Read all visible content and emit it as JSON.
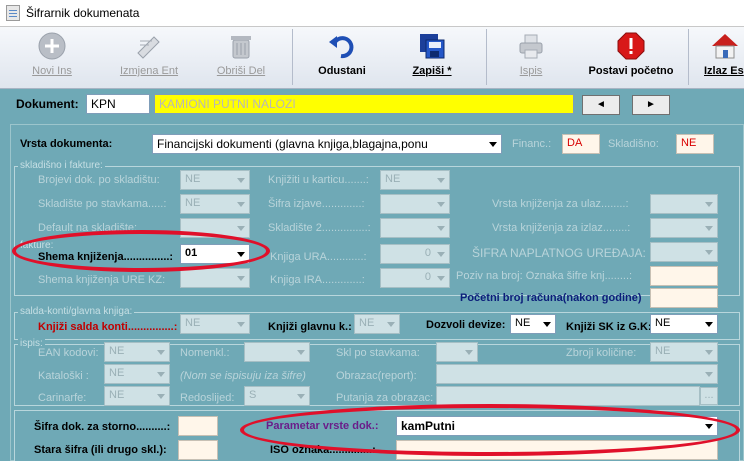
{
  "window": {
    "title": "Šifrarnik dokumenata"
  },
  "toolbar": {
    "new_label": "Novi Ins",
    "edit_label": "Izmjena Ent",
    "delete_label": "Obriši Del",
    "cancel_label": "Odustani",
    "save_label": "Zapiši *",
    "print_label": "Ispis",
    "reset_label": "Postavi početno",
    "exit_label": "Izlaz Es"
  },
  "document": {
    "label": "Dokument:",
    "code": "KPN",
    "name": "KAMIONI PUTNI NALOZI",
    "prev_label": "◄",
    "next_label": "►"
  },
  "vrsta": {
    "label": "Vrsta dokumenta:",
    "value": "Financijski dokumenti (glavna knjiga,blagajna,ponu",
    "financ_label": "Financ.:",
    "financ_value": "DA",
    "skladisno_label": "Skladišno:",
    "skladisno_value": "NE"
  },
  "skladisno": {
    "title": "skladišno i fakture:",
    "brojevi_label": "Brojevi dok. po skladištu:",
    "brojevi_value": "NE",
    "skladiste_label": "Skladište po stavkama.....:",
    "skladiste_value": "NE",
    "default_label": "Default na skladište:",
    "knjiziti_label": "Knjižiti u karticu.......:",
    "knjiziti_value": "NE",
    "sifra_izjave_label": "Šifra izjave.............:",
    "skladiste2_label": "Skladište 2...............:",
    "vrsta_ulaz_label": "Vrsta knjiženja za ulaz........:",
    "vrsta_izlaz_label": "Vrsta knjiženja za izlaz........:"
  },
  "fakture": {
    "title": "fakture:",
    "shema_label": "Shema knjiženja...............:",
    "shema_value": "01",
    "shema_ure_label": "Shema knjiženja URE KZ:",
    "knjiga_ura_label": "Knjiga URA............:",
    "knjiga_ura_value": "0",
    "knjiga_ira_label": "Knjiga IRA.............:",
    "knjiga_ira_value": "0",
    "naplatni_label": "ŠIFRA NAPLATNOG UREĐAJA:",
    "poziv_label": "Poziv na broj: Oznaka šifre knj........:",
    "pocetni_label": "Početni broj računa(nakon godine)"
  },
  "saldakonti": {
    "title": "salda-konti/glavna knjiga:",
    "knjizi_sk_label": "Knjiži salda konti...............:",
    "knjizi_sk_value": "NE",
    "knjizi_gk_label": "Knjiži glavnu k.:",
    "knjizi_gk_value": "NE",
    "dozvoli_label": "Dozvoli devize:",
    "dozvoli_value": "NE",
    "sk_gk_label": "Knjiži SK iz G.K:",
    "sk_gk_value": "NE"
  },
  "ispis": {
    "title": "ispis:",
    "ean_label": "EAN kodovi:",
    "ean_value": "NE",
    "nomenkl_label": "Nomenkl.:",
    "skl_label": "Skl po stavkama:",
    "zbroji_label": "Zbroji količine:",
    "zbroji_value": "NE",
    "katalog_label": "Kataloški :",
    "katalog_value": "NE",
    "nom_note": "(Nom se ispisuju iza šifre)",
    "obrazac_label": "Obrazac(report):",
    "carinski_label": "Carinarfe:",
    "carinski_value": "NE",
    "redoslijed_label": "Redoslijed:",
    "redoslijed_value": "S",
    "putanja_label": "Putanja za obrazac:",
    "browse_label": "..."
  },
  "bottom": {
    "storno_label": "Šifra dok. za storno..........:",
    "stara_label": "Stara šifra (ili drugo skl.):",
    "parametar_label": "Parametar vrste dok.:",
    "parametar_value": "kamPutni",
    "iso_label": "ISO oznaka..............:"
  },
  "colors": {
    "background": "#6fa9b6",
    "highlight_yellow": "#ffff00",
    "annotation_red": "#e0102a"
  }
}
